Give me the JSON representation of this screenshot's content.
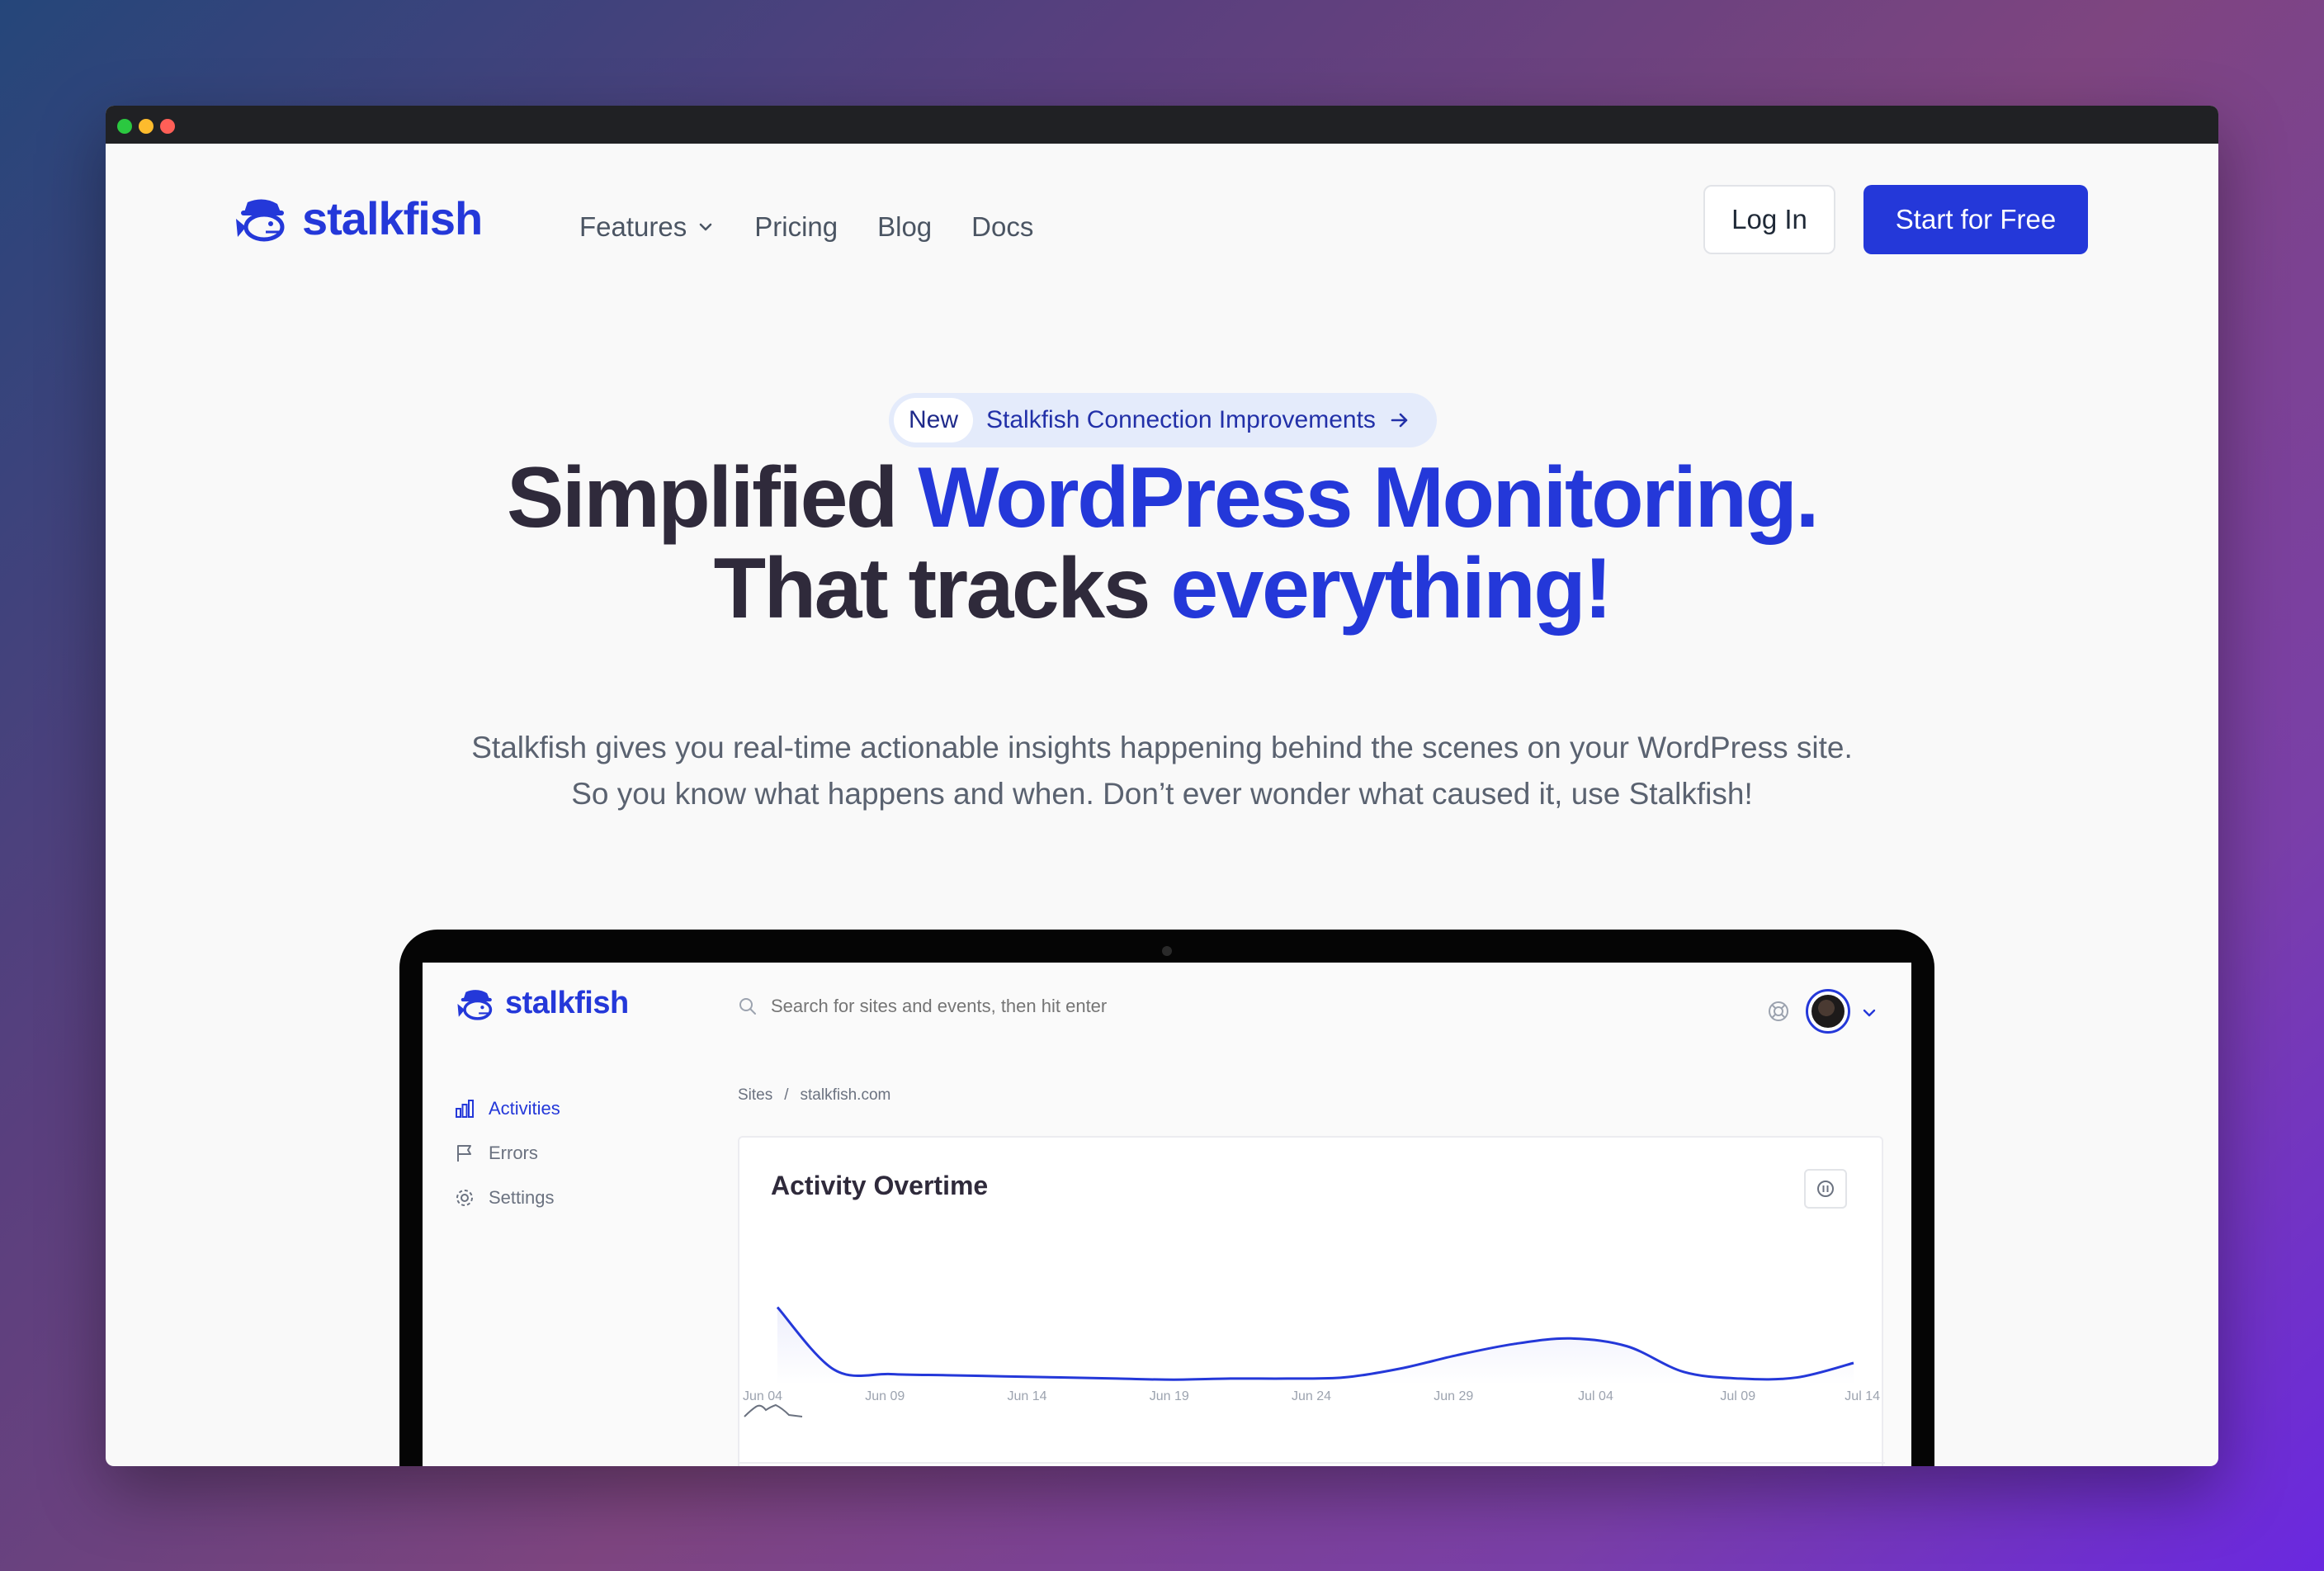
{
  "nav": {
    "logo_text": "stalkfish",
    "links": [
      "Features",
      "Pricing",
      "Blog",
      "Docs"
    ],
    "login_label": "Log In",
    "start_label": "Start for Free"
  },
  "announcement": {
    "tag": "New",
    "text": "Stalkfish Connection Improvements"
  },
  "hero": {
    "line1_plain": "Simplified ",
    "line1_accent": "WordPress Monitoring.",
    "line2_plain": "That tracks ",
    "line2_accent": "everything!",
    "subtext_line1": "Stalkfish gives you real-time actionable insights happening behind the scenes on your WordPress site.",
    "subtext_line2": "So you know what happens and when. Don’t ever wonder what caused it, use Stalkfish!"
  },
  "app": {
    "logo_text": "stalkfish",
    "search_placeholder": "Search for sites and events, then hit enter",
    "sidebar": [
      "Activities",
      "Errors",
      "Settings"
    ],
    "breadcrumb": [
      "Sites",
      "/",
      "stalkfish.com"
    ],
    "card_title": "Activity Overtime"
  },
  "colors": {
    "accent": "#2438d9",
    "heading": "#2f2a3b",
    "muted": "#5a6270"
  },
  "chart_data": {
    "type": "line",
    "x": [
      "Jun 04",
      "Jun 09",
      "Jun 14",
      "Jun 19",
      "Jun 24",
      "Jun 29",
      "Jul 04",
      "Jul 09",
      "Jul 14"
    ],
    "series": [
      {
        "values": [
          70,
          14,
          10,
          9,
          8,
          7,
          6,
          5,
          6,
          6,
          7,
          15,
          27,
          37,
          42,
          35,
          12,
          6,
          7,
          20
        ]
      }
    ],
    "ylim": [
      0,
      100
    ],
    "grid": false,
    "legend": "none"
  }
}
